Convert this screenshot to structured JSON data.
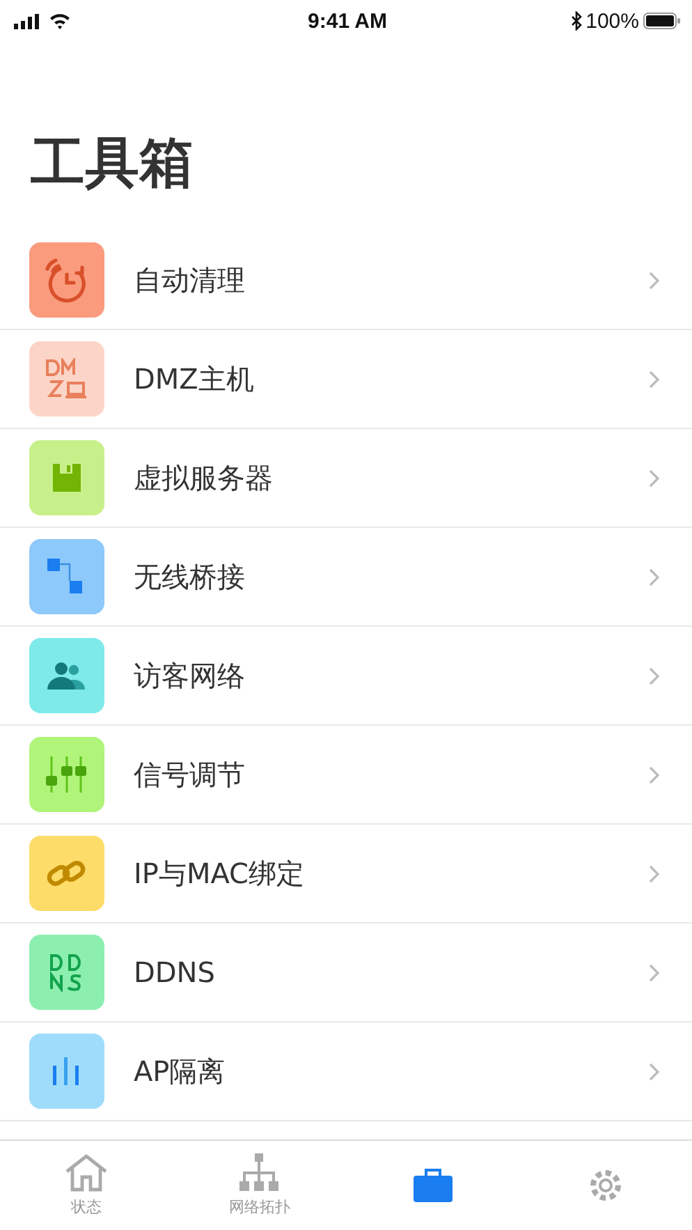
{
  "status_bar": {
    "time": "9:41 AM",
    "battery": "100%"
  },
  "title": "工具箱",
  "items": [
    {
      "label": "自动清理",
      "kind": "clock",
      "color": "#fb9b7e"
    },
    {
      "label": "DMZ主机",
      "kind": "dmz",
      "color": "#fdd5c8"
    },
    {
      "label": "虚拟服务器",
      "kind": "disk",
      "color": "#c8f08a"
    },
    {
      "label": "无线桥接",
      "kind": "bridge",
      "color": "#8ec9fb"
    },
    {
      "label": "访客网络",
      "kind": "guests",
      "color": "#7eeaea"
    },
    {
      "label": "信号调节",
      "kind": "sliders",
      "color": "#b0f47a"
    },
    {
      "label": "IP与MAC绑定",
      "kind": "link",
      "color": "#fddc6a"
    },
    {
      "label": "DDNS",
      "kind": "ddns",
      "color": "#8cefb0"
    },
    {
      "label": "AP隔离",
      "kind": "bars",
      "color": "#9fdcfb"
    }
  ],
  "tab_bar": [
    {
      "label": "状态",
      "kind": "home",
      "selected": false
    },
    {
      "label": "网络拓扑",
      "kind": "tree",
      "selected": false
    },
    {
      "kind": "toolbox",
      "selected": true
    },
    {
      "kind": "gear",
      "selected": false
    }
  ]
}
